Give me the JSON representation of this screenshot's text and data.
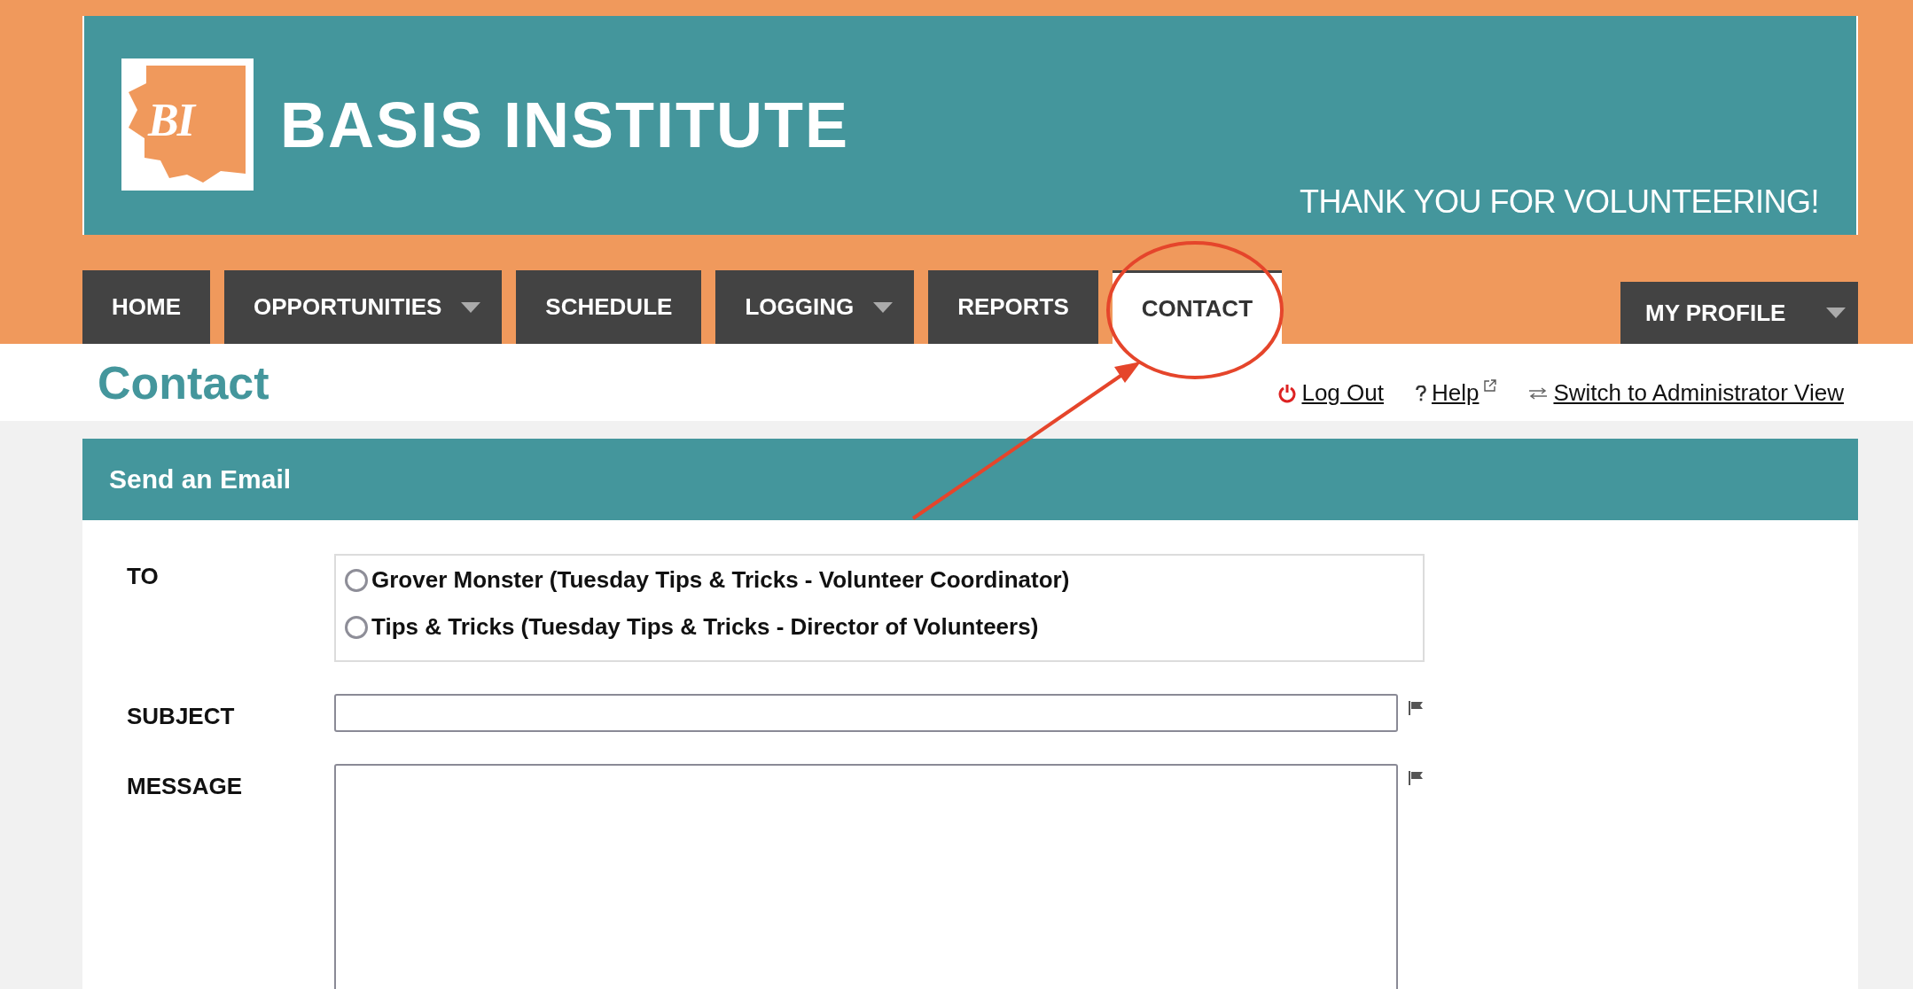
{
  "banner": {
    "logo_text": "BI",
    "title": "BASIS INSTITUTE",
    "tagline": "THANK YOU FOR VOLUNTEERING!"
  },
  "nav": {
    "tabs": [
      {
        "label": "HOME",
        "dropdown": false,
        "selected": false
      },
      {
        "label": "OPPORTUNITIES",
        "dropdown": true,
        "selected": false
      },
      {
        "label": "SCHEDULE",
        "dropdown": false,
        "selected": false
      },
      {
        "label": "LOGGING",
        "dropdown": true,
        "selected": false
      },
      {
        "label": "REPORTS",
        "dropdown": false,
        "selected": false
      },
      {
        "label": "CONTACT",
        "dropdown": false,
        "selected": true
      }
    ],
    "profile": {
      "label": "MY PROFILE",
      "dropdown": true
    }
  },
  "page_title": "Contact",
  "links": [
    {
      "kind": "logout",
      "label": "Log Out"
    },
    {
      "kind": "help",
      "label": "Help"
    },
    {
      "kind": "switch",
      "label": "Switch to Administrator View"
    }
  ],
  "form": {
    "title": "Send an Email",
    "fields": [
      {
        "kind": "radio",
        "label": "TO",
        "options": [
          {
            "label": "Grover Monster (Tuesday Tips & Tricks - Volunteer Coordinator)",
            "selected": false
          },
          {
            "label": "Tips & Tricks (Tuesday Tips & Tricks - Director of Volunteers)",
            "selected": false
          }
        ]
      },
      {
        "kind": "text",
        "label": "SUBJECT"
      },
      {
        "kind": "textarea",
        "label": "MESSAGE"
      }
    ]
  }
}
